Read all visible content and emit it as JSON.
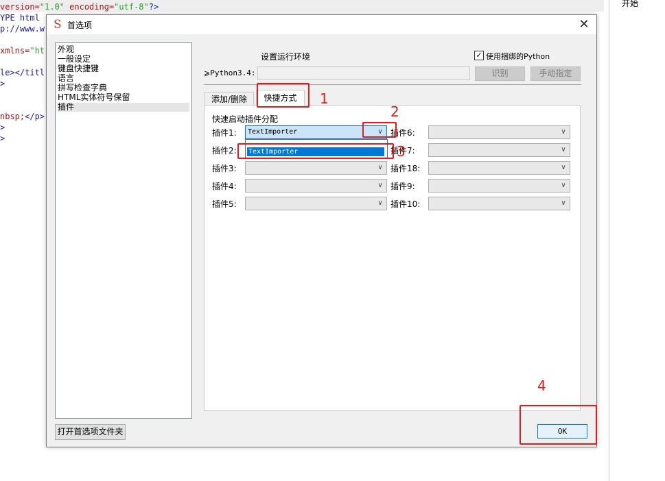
{
  "editor": {
    "lines": [
      {
        "parts": [
          {
            "t": "version=",
            "c": "c-attr"
          },
          {
            "t": "\"1.0\"",
            "c": "c-val"
          },
          {
            "t": " encoding=",
            "c": "c-attr"
          },
          {
            "t": "\"utf-8\"",
            "c": "c-val"
          },
          {
            "t": "?>",
            "c": "c-tag"
          }
        ]
      },
      {
        "parts": [
          {
            "t": "YPE html",
            "c": "c-tag"
          }
        ]
      },
      {
        "parts": [
          {
            "t": "p://www.w",
            "c": "c-tag"
          }
        ]
      },
      {
        "parts": [
          {
            "t": "",
            "c": "c-plain"
          }
        ]
      },
      {
        "parts": [
          {
            "t": "xmlns=",
            "c": "c-attr"
          },
          {
            "t": "\"ht",
            "c": "c-val"
          }
        ]
      },
      {
        "parts": [
          {
            "t": "",
            "c": "c-plain"
          }
        ]
      },
      {
        "parts": [
          {
            "t": "le>",
            "c": "c-tag"
          },
          {
            "t": "</titl",
            "c": "c-tag"
          }
        ]
      },
      {
        "parts": [
          {
            "t": ">",
            "c": "c-tag"
          }
        ]
      },
      {
        "parts": [
          {
            "t": "",
            "c": "c-plain"
          }
        ]
      },
      {
        "parts": [
          {
            "t": "",
            "c": "c-plain"
          }
        ]
      },
      {
        "parts": [
          {
            "t": "nbsp;",
            "c": "c-attr"
          },
          {
            "t": "</p>",
            "c": "c-tag"
          }
        ]
      },
      {
        "parts": [
          {
            "t": ">",
            "c": "c-tag"
          }
        ]
      },
      {
        "parts": [
          {
            "t": ">",
            "c": "c-tag"
          }
        ]
      }
    ]
  },
  "right_panel_text": "开始",
  "dialog": {
    "title": "首选项",
    "title_icon": "S",
    "close_glyph": "✕",
    "categories": [
      "外观",
      "一般设定",
      "键盘快捷键",
      "语言",
      "拼写检查字典",
      "HTML实体符号保留",
      "插件"
    ],
    "selected_category": "插件",
    "open_folder_button": "打开首选项文件夹",
    "env_label": "设置运行环境",
    "use_python_label": "使用捆绑的Python",
    "use_python_checked": true,
    "python_label": "⩾Python3.4:",
    "python_path": "",
    "identify_button": "识别",
    "manual_button": "手动指定",
    "tabs": [
      "添加/删除",
      "快捷方式"
    ],
    "active_tab": "快捷方式",
    "assign_label": "快速启动插件分配",
    "left_plugins": [
      {
        "label": "插件1:",
        "value": "TextImporter"
      },
      {
        "label": "插件2:",
        "value": ""
      },
      {
        "label": "插件3:",
        "value": ""
      },
      {
        "label": "插件4:",
        "value": ""
      },
      {
        "label": "插件5:",
        "value": ""
      }
    ],
    "right_plugins": [
      {
        "label": "插件6:",
        "value": ""
      },
      {
        "label": "插件7:",
        "value": ""
      },
      {
        "label": "插件18:",
        "value": ""
      },
      {
        "label": "插件9:",
        "value": ""
      },
      {
        "label": "插件10:",
        "value": ""
      }
    ],
    "dropdown_option": "TextImporter",
    "ok_button": "OK"
  },
  "annotations": [
    "1",
    "2",
    "3",
    "4"
  ],
  "colors": {
    "annotation": "#e31b1b",
    "selection": "#0078d7"
  }
}
